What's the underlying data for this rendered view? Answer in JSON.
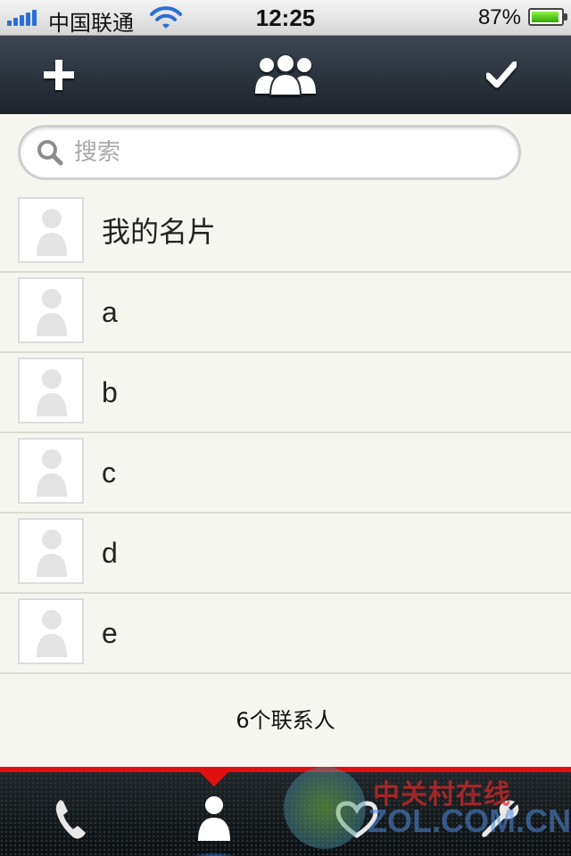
{
  "status_bar": {
    "carrier": "中国联通",
    "time": "12:25",
    "battery": "87%",
    "battery_level": 0.87,
    "signal_bars": 5
  },
  "nav_bar": {
    "left_icon": "plus-icon",
    "center_icon": "group-icon",
    "right_icon": "checkmark-icon"
  },
  "search": {
    "placeholder": "搜索",
    "value": ""
  },
  "contacts": [
    {
      "name": "我的名片"
    },
    {
      "name": "a"
    },
    {
      "name": "b"
    },
    {
      "name": "c"
    },
    {
      "name": "d"
    },
    {
      "name": "e"
    }
  ],
  "contact_count": "6个联系人",
  "tab_bar": {
    "tabs": [
      {
        "icon": "phone-icon",
        "active": false
      },
      {
        "icon": "contacts-icon",
        "active": true
      },
      {
        "icon": "heart-icon",
        "active": false
      },
      {
        "icon": "wrench-icon",
        "active": false
      }
    ],
    "accent_color": "#e11010"
  },
  "watermark": {
    "cn": "中关村在线",
    "en": "ZOL.COM.CN"
  }
}
